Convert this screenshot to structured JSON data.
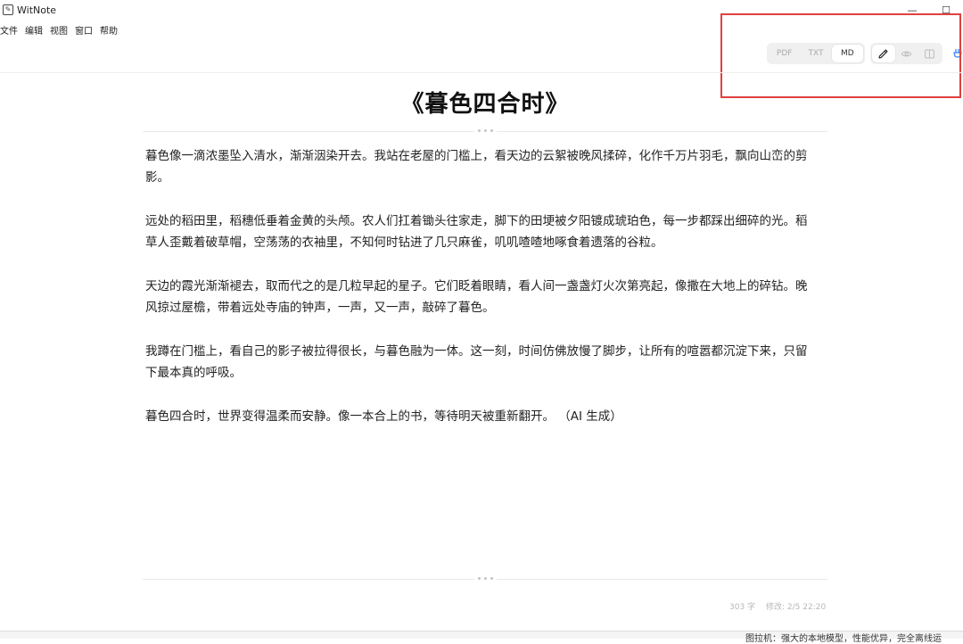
{
  "window": {
    "title": "WitNote",
    "minimize_symbol": "—",
    "maximize_symbol": "☐"
  },
  "menu": [
    "文件",
    "编辑",
    "视图",
    "窗口",
    "帮助"
  ],
  "toolbar": {
    "formats": [
      {
        "label": "PDF",
        "active": false
      },
      {
        "label": "TXT",
        "active": false
      },
      {
        "label": "MD",
        "active": true
      }
    ],
    "modes": [
      {
        "icon": "pencil-icon",
        "active": true
      },
      {
        "icon": "eye-icon",
        "active": false
      },
      {
        "icon": "split-view-icon",
        "active": false
      }
    ],
    "accent": "#3b82f6"
  },
  "document": {
    "title": "《暮色四合时》",
    "paragraphs": [
      "暮色像一滴浓墨坠入清水，渐渐洇染开去。我站在老屋的门槛上，看天边的云絮被晚风揉碎，化作千万片羽毛，飘向山峦的剪影。",
      "远处的稻田里，稻穗低垂着金黄的头颅。农人们扛着锄头往家走，脚下的田埂被夕阳镀成琥珀色，每一步都踩出细碎的光。稻草人歪戴着破草帽，空荡荡的衣袖里，不知何时钻进了几只麻雀，叽叽喳喳地啄食着遗落的谷粒。",
      "天边的霞光渐渐褪去，取而代之的是几粒早起的星子。它们眨着眼睛，看人间一盏盏灯火次第亮起，像撒在大地上的碎钻。晚风掠过屋檐，带着远处寺庙的钟声，一声，又一声，敲碎了暮色。",
      "我蹲在门槛上，看自己的影子被拉得很长，与暮色融为一体。这一刻，时间仿佛放慢了脚步，让所有的喧嚣都沉淀下来，只留下最本真的呼吸。",
      "暮色四合时，世界变得温柔而安静。像一本合上的书，等待明天被重新翻开。 （AI 生成）"
    ]
  },
  "status": {
    "word_count": "303 字",
    "modified": "修改: 2/5 22:20"
  },
  "background_text": "图拉机：强大的本地模型，性能优异，完全离线运"
}
